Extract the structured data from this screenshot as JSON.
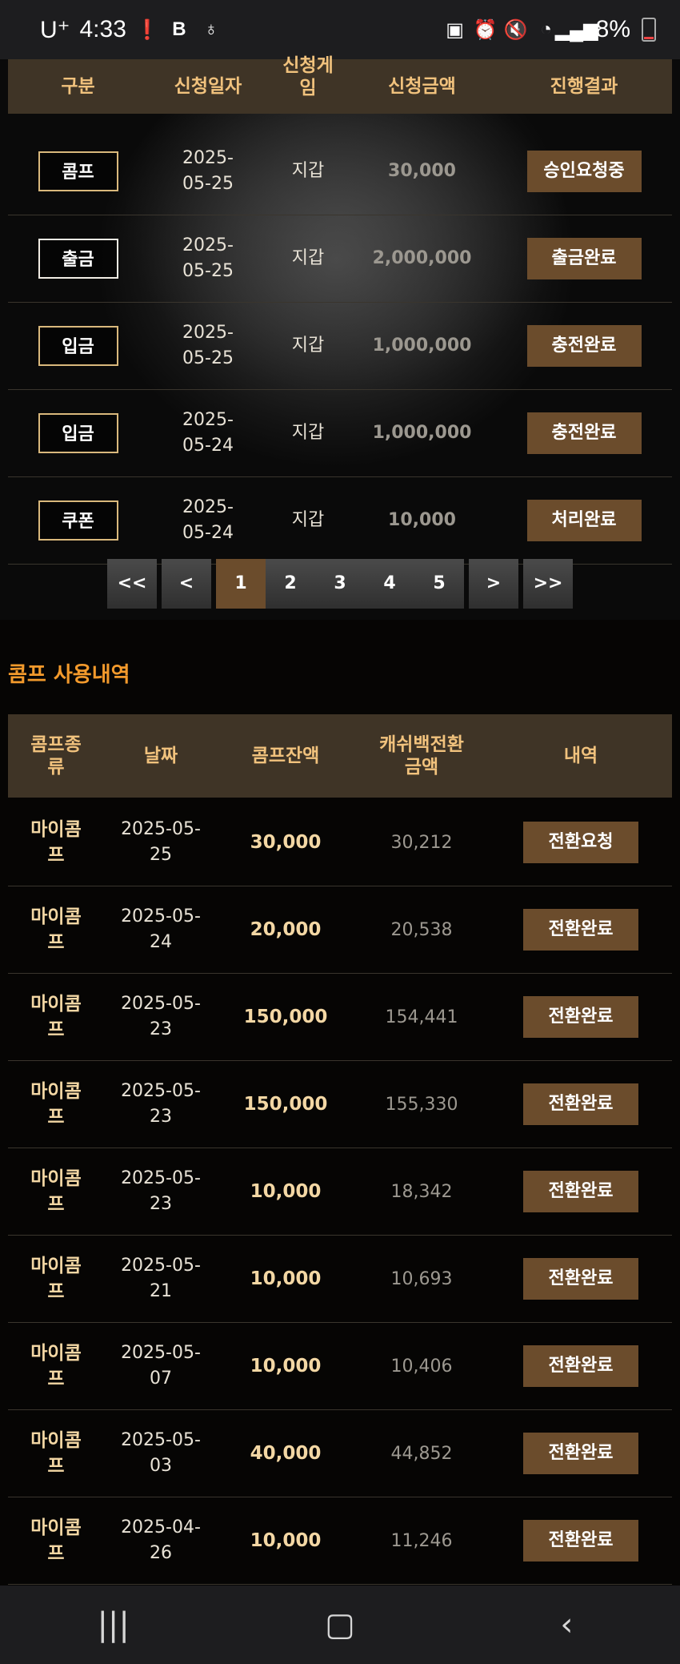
{
  "status_bar": {
    "carrier": "U⁺",
    "time": "4:33",
    "battery": "8%"
  },
  "history_table": {
    "headers": [
      "구분",
      "신청일자",
      "신청게\n임",
      "신청금액",
      "진행결과"
    ],
    "rows": [
      {
        "type": "콤프",
        "date1": "2025-",
        "date2": "05-25",
        "game": "지갑",
        "amount": "30,000",
        "status": "승인요청중"
      },
      {
        "type": "출금",
        "date1": "2025-",
        "date2": "05-25",
        "game": "지갑",
        "amount": "2,000,000",
        "status": "출금완료"
      },
      {
        "type": "입금",
        "date1": "2025-",
        "date2": "05-25",
        "game": "지갑",
        "amount": "1,000,000",
        "status": "충전완료"
      },
      {
        "type": "입금",
        "date1": "2025-",
        "date2": "05-24",
        "game": "지갑",
        "amount": "1,000,000",
        "status": "충전완료"
      },
      {
        "type": "쿠폰",
        "date1": "2025-",
        "date2": "05-24",
        "game": "지갑",
        "amount": "10,000",
        "status": "처리완료"
      }
    ]
  },
  "pagination": {
    "first": "<<",
    "prev": "<",
    "pages": [
      "1",
      "2",
      "3",
      "4",
      "5"
    ],
    "next": ">",
    "last": ">>",
    "current": "1"
  },
  "comp_section": {
    "title": "콤프 사용내역",
    "headers": {
      "type1": "콤프종",
      "type2": "류",
      "date": "날짜",
      "balance": "콤프잔액",
      "cash1": "캐쉬백전환",
      "cash2": "금액",
      "detail": "내역"
    },
    "rows": [
      {
        "type1": "마이콤",
        "type2": "프",
        "date1": "2025-05-",
        "date2": "25",
        "balance": "30,000",
        "cash": "30,212",
        "status": "전환요청"
      },
      {
        "type1": "마이콤",
        "type2": "프",
        "date1": "2025-05-",
        "date2": "24",
        "balance": "20,000",
        "cash": "20,538",
        "status": "전환완료"
      },
      {
        "type1": "마이콤",
        "type2": "프",
        "date1": "2025-05-",
        "date2": "23",
        "balance": "150,000",
        "cash": "154,441",
        "status": "전환완료"
      },
      {
        "type1": "마이콤",
        "type2": "프",
        "date1": "2025-05-",
        "date2": "23",
        "balance": "150,000",
        "cash": "155,330",
        "status": "전환완료"
      },
      {
        "type1": "마이콤",
        "type2": "프",
        "date1": "2025-05-",
        "date2": "23",
        "balance": "10,000",
        "cash": "18,342",
        "status": "전환완료"
      },
      {
        "type1": "마이콤",
        "type2": "프",
        "date1": "2025-05-",
        "date2": "21",
        "balance": "10,000",
        "cash": "10,693",
        "status": "전환완료"
      },
      {
        "type1": "마이콤",
        "type2": "프",
        "date1": "2025-05-",
        "date2": "07",
        "balance": "10,000",
        "cash": "10,406",
        "status": "전환완료"
      },
      {
        "type1": "마이콤",
        "type2": "프",
        "date1": "2025-05-",
        "date2": "03",
        "balance": "40,000",
        "cash": "44,852",
        "status": "전환완료"
      },
      {
        "type1": "마이콤",
        "type2": "프",
        "date1": "2025-04-",
        "date2": "26",
        "balance": "10,000",
        "cash": "11,246",
        "status": "전환완료"
      }
    ]
  },
  "nav_bar": {
    "recents_icon": "recents-icon",
    "home_icon": "home-icon",
    "back_icon": "back-icon"
  },
  "colors": {
    "accent": "#f39a2c",
    "header_text": "#f1c27d",
    "button_bg": "#6b4c2c",
    "header_bg": "#3f3426"
  }
}
